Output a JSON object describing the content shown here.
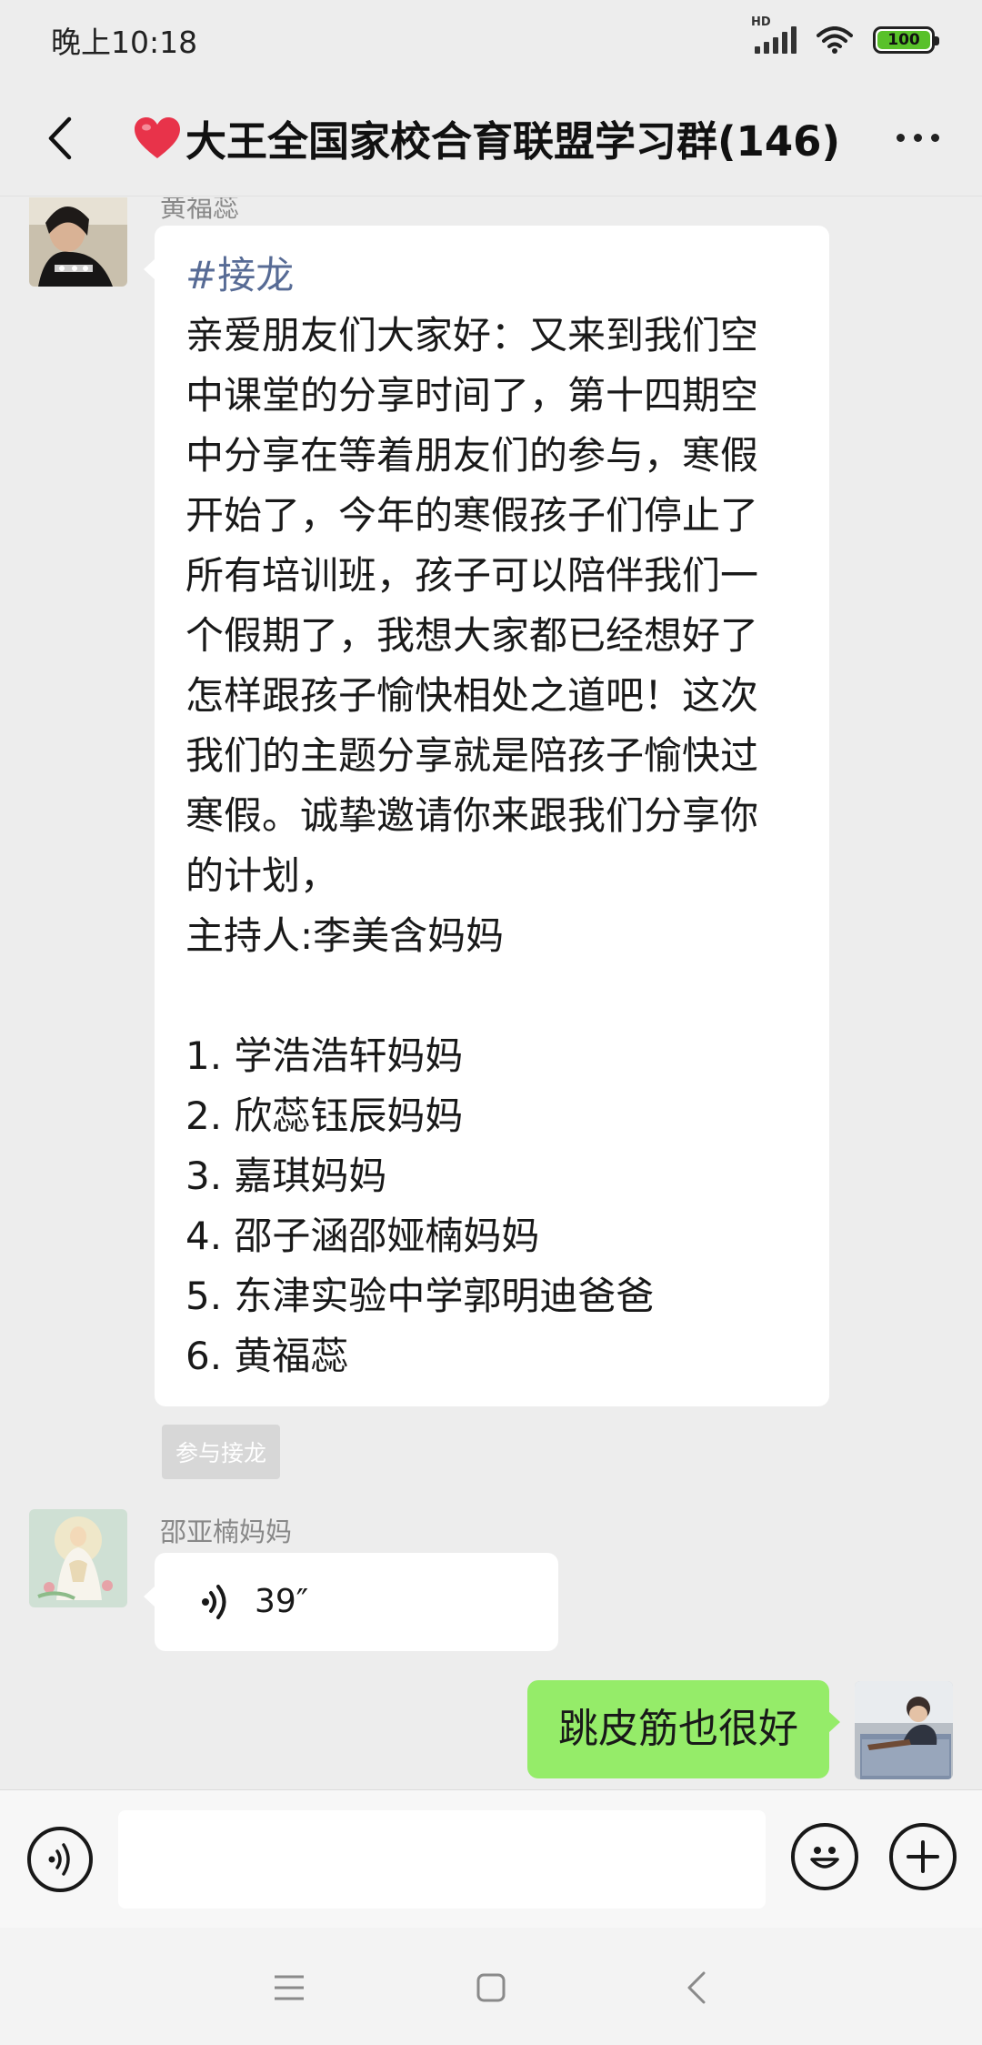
{
  "status_bar": {
    "time": "晚上10:18",
    "network": "HD",
    "battery": "100",
    "battery_color": "#59c12a"
  },
  "header": {
    "title": "大王全国家校合育联盟学习群(146)",
    "title_prefix_icon": "red-heart-icon",
    "back_icon": "chevron-left-icon",
    "more_icon": "more-dots-icon"
  },
  "messages": {
    "jielong": {
      "sender": "黄福蕊",
      "tag": "#接龙",
      "lines": [
        "亲爱朋友们大家好：又来到我们空",
        "中课堂的分享时间了，第十四期空",
        "中分享在等着朋友们的参与，寒假",
        "开始了，今年的寒假孩子们停止了",
        "所有培训班，孩子可以陪伴我们一",
        "个假期了，我想大家都已经想好了",
        "怎样跟孩子愉快相处之道吧！这次",
        "我们的主题分享就是陪孩子愉快过",
        "寒假。诚挚邀请你来跟我们分享你",
        "的计划，",
        "主持人:李美含妈妈"
      ],
      "list": [
        "1. 学浩浩轩妈妈",
        "2. 欣蕊钰辰妈妈",
        "3. 嘉琪妈妈",
        "4. 邵子涵邵娅楠妈妈",
        "5. 东津实验中学郭明迪爸爸",
        "6. 黄福蕊"
      ],
      "join_label": "参与接龙"
    },
    "voice": {
      "sender": "邵亚楠妈妈",
      "duration": "39″"
    },
    "sent": {
      "text": "跳皮筋也很好",
      "bubble_color": "#95ec69"
    }
  },
  "input_bar": {
    "voice_icon": "voice-wave-icon",
    "emoji_icon": "smiley-icon",
    "plus_icon": "plus-circle-icon",
    "value": ""
  },
  "nav": {
    "icons": [
      "menu-lines-icon",
      "home-square-icon",
      "back-triangle-icon"
    ]
  }
}
